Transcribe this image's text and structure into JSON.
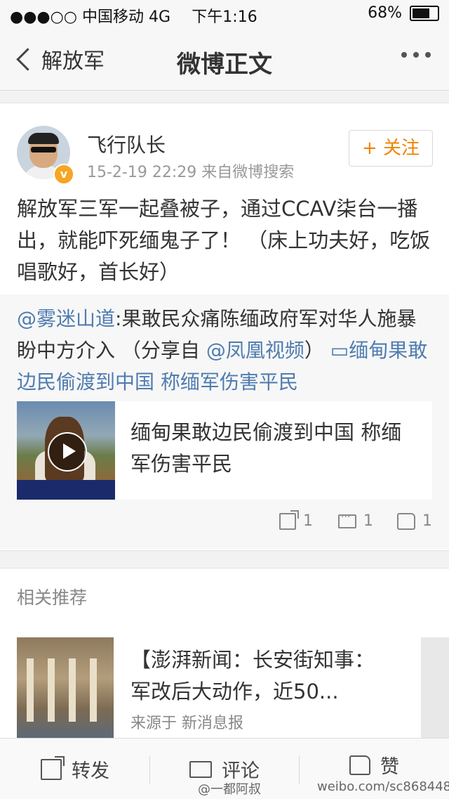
{
  "status_bar": {
    "carrier": "●●●○○ 中国移动  4G",
    "time": "下午1:16",
    "battery": "68%"
  },
  "nav": {
    "back_label": "解放军",
    "title": "微博正文"
  },
  "post": {
    "username": "飞行队长",
    "meta": "15-2-19 22:29  来自微博搜索",
    "follow_label": "+ 关注",
    "text": "解放军三军一起叠被子，通过CCAV柒台一播出，就能吓死缅鬼子了！  （床上功夫好，吃饭唱歌好，首长好）",
    "repost": {
      "mention": "@雾迷山道",
      "text": ":果敢民众痛陈缅政府军对华人施暴 盼中方介入 （分享自 ",
      "source_mention": "@凤凰视频",
      "text_after": "） ",
      "link_text": "▭缅甸果敢边民偷渡到中国 称缅军伤害平民",
      "video_title": "缅甸果敢边民偷渡到中国 称缅军伤害平民",
      "share_count": "1",
      "comment_count": "1",
      "like_count": "1"
    }
  },
  "related": {
    "header": "相关推荐",
    "item_title": "【澎湃新闻：长安街知事：军改后大动作，近50...",
    "item_source": "来源于 新消息报"
  },
  "toolbar": {
    "repost_label": "转发",
    "comment_label": "评论",
    "like_label": "赞"
  },
  "watermarks": {
    "left": "@一都阿叔",
    "right": "weibo.com/sc868448"
  }
}
